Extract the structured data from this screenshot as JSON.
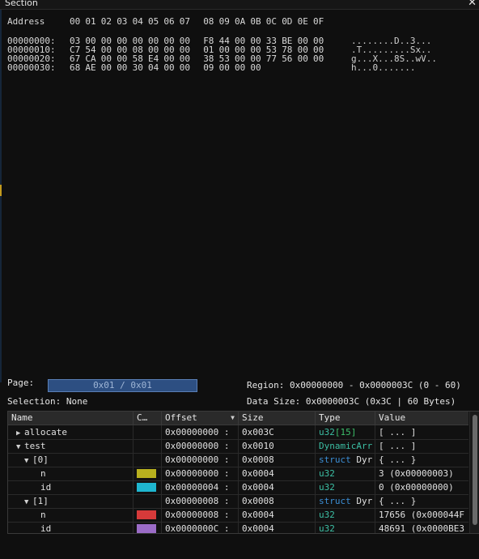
{
  "window": {
    "title": "Section",
    "close_glyph": "✕"
  },
  "hex_view": {
    "address_label": "Address",
    "header_bytes": [
      "00",
      "01",
      "02",
      "03",
      "04",
      "05",
      "06",
      "07",
      "08",
      "09",
      "0A",
      "0B",
      "0C",
      "0D",
      "0E",
      "0F"
    ],
    "rows": [
      {
        "address": "00000000:",
        "bytes": [
          "03",
          "00",
          "00",
          "00",
          "00",
          "00",
          "00",
          "00",
          "F8",
          "44",
          "00",
          "00",
          "33",
          "BE",
          "00",
          "00"
        ],
        "ascii": "........D..3..."
      },
      {
        "address": "00000010:",
        "bytes": [
          "C7",
          "54",
          "00",
          "00",
          "08",
          "00",
          "00",
          "00",
          "01",
          "00",
          "00",
          "00",
          "53",
          "78",
          "00",
          "00"
        ],
        "ascii": ".T.........Sx.."
      },
      {
        "address": "00000020:",
        "bytes": [
          "67",
          "CA",
          "00",
          "00",
          "58",
          "E4",
          "00",
          "00",
          "38",
          "53",
          "00",
          "00",
          "77",
          "56",
          "00",
          "00"
        ],
        "ascii": "g...X...8S..wV.."
      },
      {
        "address": "00000030:",
        "bytes": [
          "68",
          "AE",
          "00",
          "00",
          "30",
          "04",
          "00",
          "00",
          "09",
          "00",
          "00",
          "00",
          "",
          "",
          "",
          ""
        ],
        "ascii": "h...0......."
      }
    ]
  },
  "footer": {
    "page_label": "Page:",
    "page_value": "0x01 / 0x01",
    "region_text": "Region: 0x00000000 - 0x0000003C (0 - 60)",
    "selection_text": "Selection: None",
    "data_size_text": "Data Size: 0x0000003C (0x3C | 60 Bytes)"
  },
  "table": {
    "headers": {
      "name": "Name",
      "color": "C…",
      "offset": "Offset",
      "size": "Size",
      "type": "Type",
      "value": "Value"
    },
    "sort_arrow": "▼",
    "rows": [
      {
        "indent": 0,
        "chevron": "▶",
        "name": "allocate",
        "color": "",
        "offset": "0x00000000 :",
        "size": "0x003C",
        "type_prefix": "u32",
        "type_suffix": "[15]",
        "type_style": "array",
        "value": "[ ... ]"
      },
      {
        "indent": 0,
        "chevron": "▼",
        "name": "test",
        "color": "",
        "offset": "0x00000000 :",
        "size": "0x0010",
        "type_prefix": "DynamicArr",
        "type_suffix": "",
        "type_style": "teal",
        "value": "[ ... ]"
      },
      {
        "indent": 1,
        "chevron": "▼",
        "name": "[0]",
        "color": "",
        "offset": "0x00000000 :",
        "size": "0x0008",
        "type_prefix": "struct",
        "type_suffix": " Dyr",
        "type_style": "struct",
        "value": "{ ... }"
      },
      {
        "indent": 2,
        "chevron": "",
        "name": "n",
        "color": "#b8b01e",
        "offset": "0x00000000 :",
        "size": "0x0004",
        "type_prefix": "u32",
        "type_suffix": "",
        "type_style": "prim",
        "value": "3 (0x00000003)"
      },
      {
        "indent": 2,
        "chevron": "",
        "name": "id",
        "color": "#1fb6cf",
        "offset": "0x00000004 :",
        "size": "0x0004",
        "type_prefix": "u32",
        "type_suffix": "",
        "type_style": "prim",
        "value": "0 (0x00000000)"
      },
      {
        "indent": 1,
        "chevron": "▼",
        "name": "[1]",
        "color": "",
        "offset": "0x00000008 :",
        "size": "0x0008",
        "type_prefix": "struct",
        "type_suffix": " Dyr",
        "type_style": "struct",
        "value": "{ ... }"
      },
      {
        "indent": 2,
        "chevron": "",
        "name": "n",
        "color": "#d63a3a",
        "offset": "0x00000008 :",
        "size": "0x0004",
        "type_prefix": "u32",
        "type_suffix": "",
        "type_style": "prim",
        "value": "17656 (0x000044F"
      },
      {
        "indent": 2,
        "chevron": "",
        "name": "id",
        "color": "#9b6cc7",
        "offset": "0x0000000C :",
        "size": "0x0004",
        "type_prefix": "u32",
        "type_suffix": "",
        "type_style": "prim",
        "value": "48691 (0x0000BE3"
      }
    ]
  }
}
